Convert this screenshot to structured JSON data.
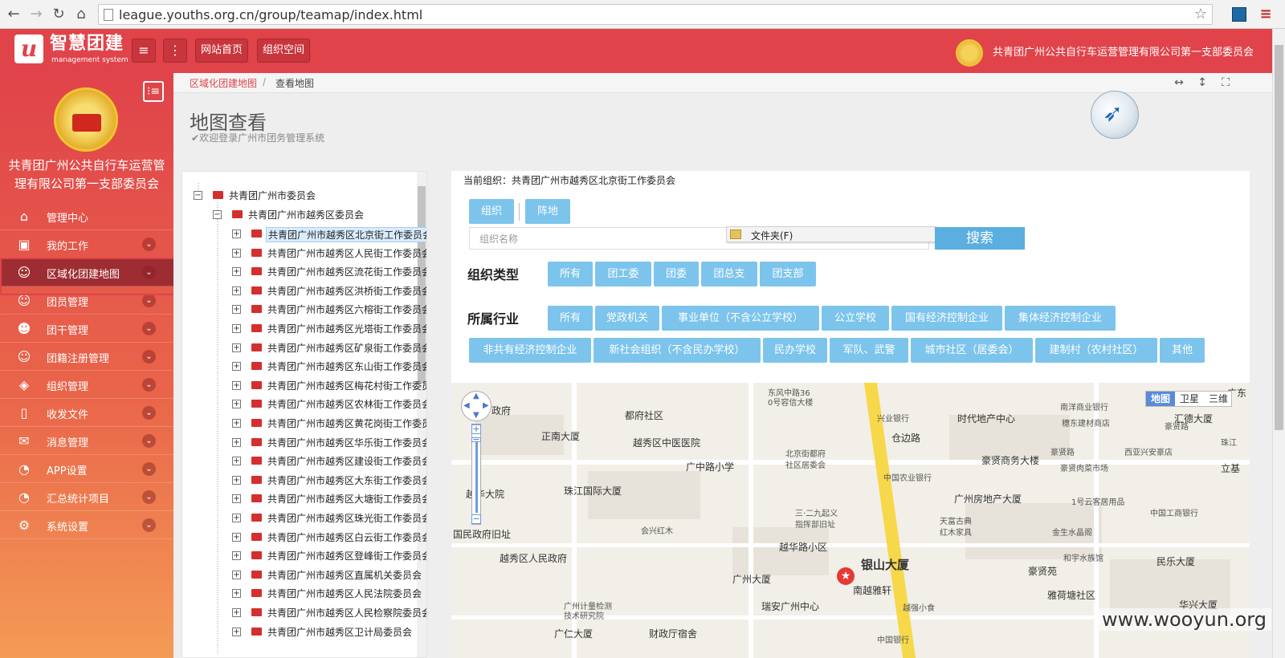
{
  "browser": {
    "url": "league.youths.org.cn/group/teamap/index.html"
  },
  "header": {
    "logo_letter": "u",
    "brand": "智慧团建",
    "brand_sub": "management system",
    "nav_home": "网站首页",
    "nav_space": "组织空间",
    "org_name": "共青团广州公共自行车运营管理有限公司第一支部委员会"
  },
  "sidebar": {
    "org_name_line1": "共青团广州公共自行车运营管",
    "org_name_line2": "理有限公司第一支部委员会",
    "items": [
      {
        "label": "管理中心",
        "icon": "home-icon"
      },
      {
        "label": "我的工作",
        "icon": "briefcase-icon"
      },
      {
        "label": "区域化团建地图",
        "icon": "user-icon"
      },
      {
        "label": "团员管理",
        "icon": "user-icon"
      },
      {
        "label": "团干管理",
        "icon": "group-icon"
      },
      {
        "label": "团籍注册管理",
        "icon": "user-icon"
      },
      {
        "label": "组织管理",
        "icon": "layers-icon"
      },
      {
        "label": "收发文件",
        "icon": "file-icon"
      },
      {
        "label": "消息管理",
        "icon": "mail-icon"
      },
      {
        "label": "APP设置",
        "icon": "gauge-icon"
      },
      {
        "label": "汇总统计项目",
        "icon": "gauge-icon"
      },
      {
        "label": "系统设置",
        "icon": "gear-icon"
      }
    ]
  },
  "breadcrumb": {
    "level1": "区域化团建地图",
    "level2": "查看地图"
  },
  "page": {
    "title": "地图查看",
    "subtitle": "欢迎登录广州市团务管理系统"
  },
  "tree": {
    "root": "共青团广州市委员会",
    "district": "共青团广州市越秀区委员会",
    "children": [
      "共青团广州市越秀区北京街工作委员会",
      "共青团广州市越秀区人民街工作委员会",
      "共青团广州市越秀区流花街工作委员会",
      "共青团广州市越秀区洪桥街工作委员会",
      "共青团广州市越秀区六榕街工作委员会",
      "共青团广州市越秀区光塔街工作委员会",
      "共青团广州市越秀区矿泉街工作委员会",
      "共青团广州市越秀区东山街工作委员会",
      "共青团广州市越秀区梅花村街工作委员",
      "共青团广州市越秀区农林街工作委员会",
      "共青团广州市越秀区黄花岗街工作委员",
      "共青团广州市越秀区华乐街工作委员会",
      "共青团广州市越秀区建设街工作委员会",
      "共青团广州市越秀区大东街工作委员会",
      "共青团广州市越秀区大塘街工作委员会",
      "共青团广州市越秀区珠光街工作委员会",
      "共青团广州市越秀区白云街工作委员会",
      "共青团广州市越秀区登峰街工作委员会",
      "共青团广州市越秀区直属机关委员会",
      "共青团广州市越秀区人民法院委员会",
      "共青团广州市越秀区人民检察院委员会",
      "共青团广州市越秀区卫计局委员会"
    ]
  },
  "panel": {
    "current_org": "当前组织：共青团广州市越秀区北京街工作委员会",
    "tab_org": "组织",
    "tab_base": "阵地",
    "search_placeholder": "组织名称",
    "search_button": "搜索",
    "folder_popup": "文件夹(F)",
    "org_type_label": "组织类型",
    "org_types": [
      "所有",
      "团工委",
      "团委",
      "团总支",
      "团支部"
    ],
    "industry_label": "所属行业",
    "industries_row1": [
      "所有",
      "党政机关",
      "事业单位（不含公立学校）",
      "公立学校",
      "国有经济控制企业",
      "集体经济控制企业"
    ],
    "industries_row2": [
      "非共有经济控制企业",
      "新社会组织（不含民办学校）",
      "民办学校",
      "军队、武警",
      "城市社区（居委会）",
      "建制村（农村社区）",
      "其他"
    ]
  },
  "map": {
    "types": [
      "地图",
      "卫星",
      "三维"
    ],
    "labels": [
      "东风中路36",
      "0号容信大楼",
      "南洋商业银行",
      "广东",
      "政府",
      "都府社区",
      "兴业银行",
      "时代地产中心",
      "穗东建材商店",
      "汇德大厦",
      "豪贤路",
      "豪贤路",
      "正南大厦",
      "越秀区中医医院",
      "北京街都府",
      "社区居委会",
      "仓边路",
      "豪贤商务大楼",
      "西亚兴安豪店",
      "珠江",
      "豪贤肉菜市场",
      "广中路小学",
      "中国农业银行",
      "立基",
      "越华大院",
      "珠江国际大厦",
      "广州房地产大厦",
      "1号云客居用品",
      "三·二九起义",
      "指挥部旧址",
      "天富古典",
      "红木家具",
      "中国工商银行",
      "会兴红木",
      "金生水晶阁",
      "国民政府旧址",
      "越华路小区",
      "和宇水族馆",
      "民乐大厦",
      "越秀区人民政府",
      "银山大厦",
      "豪贤苑",
      "广州大厦",
      "南越雅轩",
      "雅荷塘社区",
      "广州计量检测",
      "技术研究院",
      "瑞安广州中心",
      "越强小食",
      "华兴大厦",
      "广仁大厦",
      "财政厅宿舍",
      "中国银行"
    ]
  },
  "watermark": "www.wooyun.org"
}
